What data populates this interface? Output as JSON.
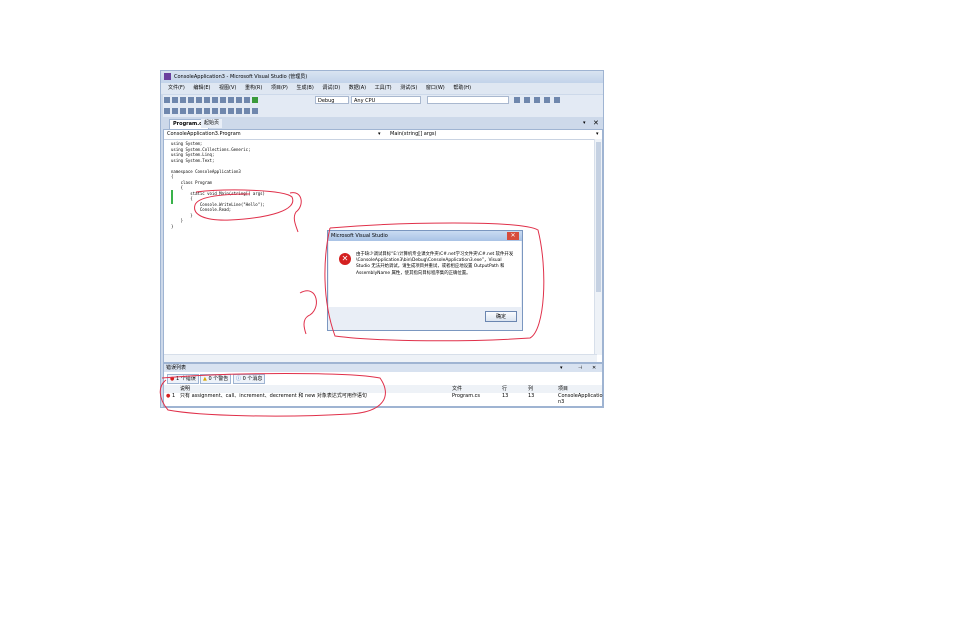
{
  "window": {
    "title": "ConsoleApplication3 - Microsoft Visual Studio (管理员)",
    "menu": [
      "文件(F)",
      "编辑(E)",
      "视图(V)",
      "重构(R)",
      "项目(P)",
      "生成(B)",
      "调试(D)",
      "数据(A)",
      "工具(T)",
      "测试(S)",
      "窗口(W)",
      "帮助(H)"
    ],
    "config_value": "Debug",
    "platform_value": "Any CPU"
  },
  "tabs": [
    {
      "label": "Program.cs",
      "active": true
    },
    {
      "label": "起始页",
      "active": false
    }
  ],
  "editor": {
    "nav_left": "ConsoleApplication3.Program",
    "nav_right": "Main(string[] args)",
    "code_lines": [
      "using System;",
      "using System.Collections.Generic;",
      "using System.Linq;",
      "using System.Text;",
      "",
      "namespace ConsoleApplication3",
      "{",
      "    class Program",
      "    {",
      "        static void Main(string[] args)",
      "        {",
      "            Console.WriteLine(\"Hello\");",
      "            Console.Read;",
      "        }",
      "    }",
      "}"
    ]
  },
  "dialog": {
    "title": "Microsoft Visual Studio",
    "close_label": "✕",
    "message": "由于缺少调试目标“E:\\计算机专业课文件夹\\C#.net学习文件夹\\C#.net 软件开发\\ConsoleApplication3\\bin\\Debug\\ConsoleApplication3.exe”，Visual Studio 无法开始调试。请生成项目并重试，或者相应地设置 OutputPath 和 AssemblyName 属性，使其指向目标程序集的正确位置。",
    "ok_label": "确定"
  },
  "error_list": {
    "title": "错误列表",
    "errors_btn": "1 个错误",
    "warnings_btn": "0 个警告",
    "messages_btn": "0 个消息",
    "headers": {
      "desc": "说明",
      "file": "文件",
      "line": "行",
      "col": "列",
      "project": "项目"
    },
    "rows": [
      {
        "num": "1",
        "desc": "只有 assignment、call、increment、decrement 和 new 对象表达式可用作语句",
        "file": "Program.cs",
        "line": "13",
        "col": "13",
        "project": "ConsoleApplication3"
      }
    ]
  },
  "icons": {
    "error": "error-circle-icon",
    "warning": "warning-icon",
    "info": "info-icon"
  },
  "colors": {
    "ink": "#e0304a",
    "accent": "#cdd9ea",
    "error_red": "#d42020"
  }
}
